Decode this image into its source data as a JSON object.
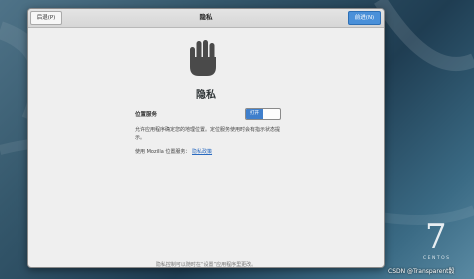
{
  "header": {
    "prev_label": "后退(P)",
    "title": "隐私",
    "next_label": "前进(N)"
  },
  "main": {
    "icon": "privacy-hand-icon",
    "heading": "隐私",
    "location": {
      "label": "位置服务",
      "toggle_text": "打开",
      "toggle_on": true,
      "description": "允许应用程序确定您的地理位置。定位服务使用时会有指示状态提示。",
      "use_text": "使用 Mozilla 位置服务：",
      "policy_link": "隐私政策"
    }
  },
  "footer": {
    "note": "隐私控制可以随时在“设置”应用程序里更改。"
  },
  "desktop": {
    "brand_number": "7",
    "brand_name": "CENTOS",
    "watermark": "CSDN @Transparent骰"
  },
  "colors": {
    "accent": "#4a90d9",
    "toggle_on": "#3f7fcc",
    "link": "#2a6ac0"
  }
}
